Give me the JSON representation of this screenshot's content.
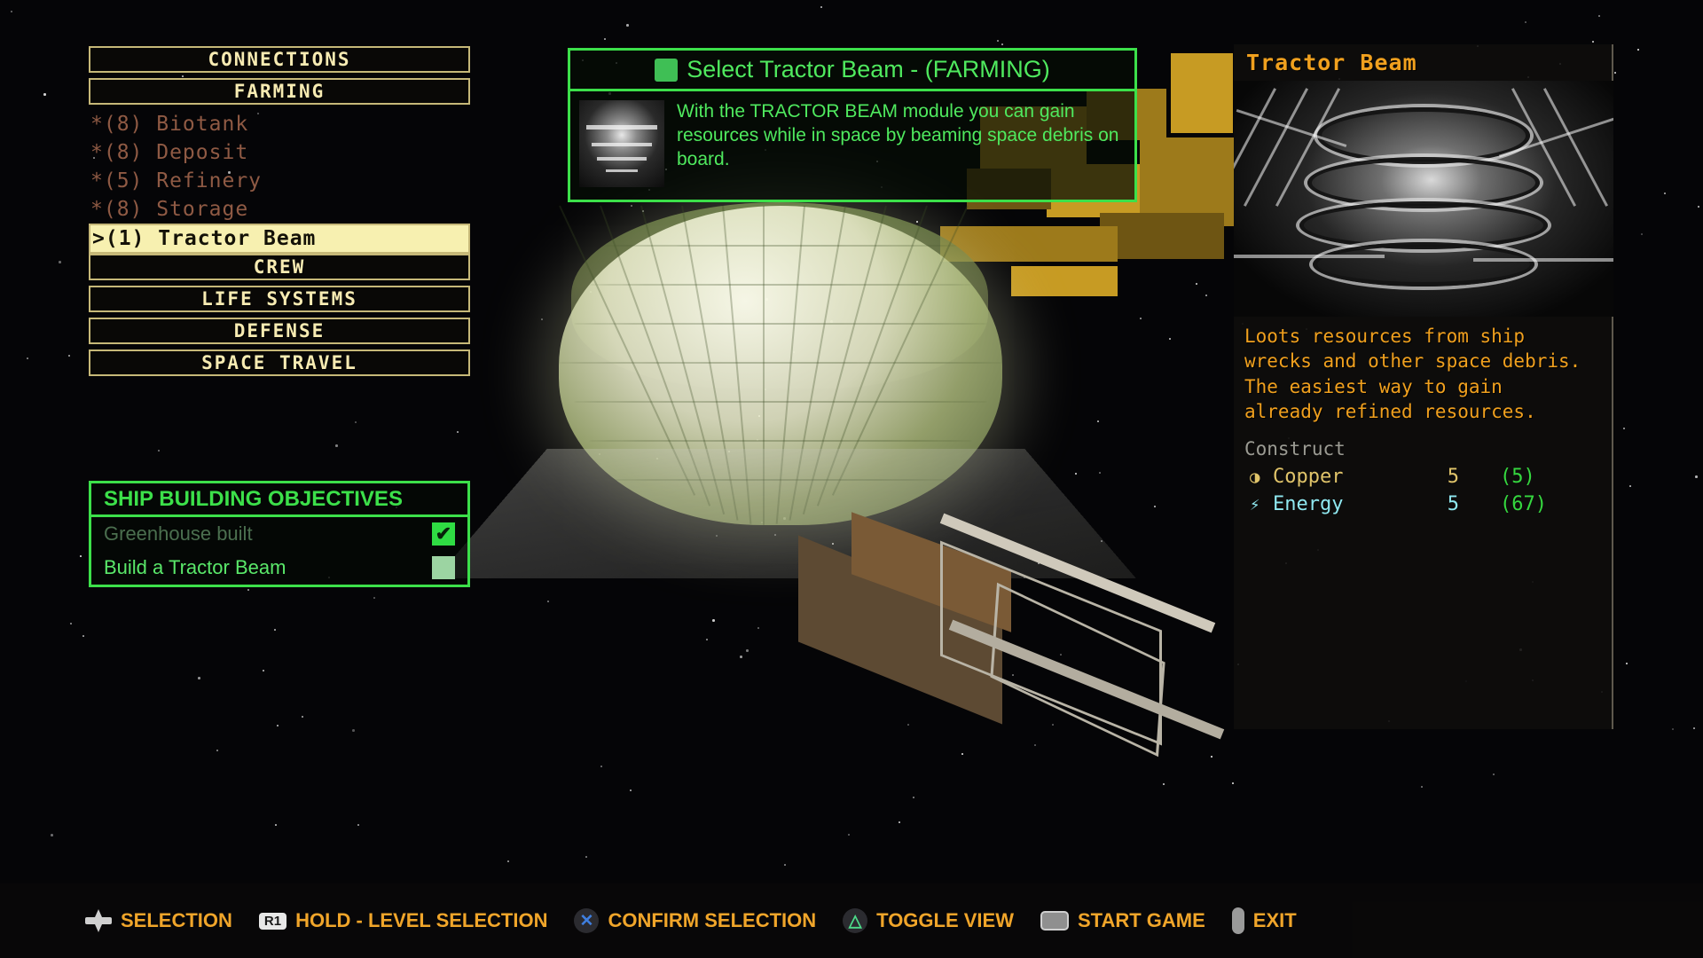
{
  "menu": {
    "items": [
      {
        "label": "CONNECTIONS",
        "type": "header"
      },
      {
        "label": "FARMING",
        "type": "header"
      },
      {
        "label": "*(8) Biotank",
        "type": "item",
        "state": "dim"
      },
      {
        "label": "*(8) Deposit",
        "type": "item",
        "state": "dim"
      },
      {
        "label": "*(5) Refinery",
        "type": "item",
        "state": "dim"
      },
      {
        "label": "*(8) Storage",
        "type": "item",
        "state": "dim"
      },
      {
        "label": ">(1) Tractor Beam",
        "type": "item",
        "state": "selected"
      },
      {
        "label": "CREW",
        "type": "header"
      },
      {
        "label": "LIFE SYSTEMS",
        "type": "header"
      },
      {
        "label": "DEFENSE",
        "type": "header"
      },
      {
        "label": "SPACE TRAVEL",
        "type": "header"
      }
    ]
  },
  "objectives": {
    "title": "SHIP BUILDING OBJECTIVES",
    "items": [
      {
        "label": "Greenhouse built",
        "checked": true,
        "check_glyph": "✔"
      },
      {
        "label": "Build a Tractor Beam",
        "checked": false,
        "check_glyph": ""
      }
    ]
  },
  "tooltip": {
    "title": "Select Tractor Beam - (FARMING)",
    "body": "With the TRACTOR BEAM module you can gain resources while in space by beaming space debris on board."
  },
  "info_panel": {
    "title": "Tractor Beam",
    "description": "Loots resources from ship\nwrecks and other space debris.\nThe easiest way to gain\nalready refined resources.",
    "construct_label": "Construct",
    "resources": [
      {
        "icon": "copper-coins-icon",
        "glyph": "◑",
        "name": "Copper",
        "amount": "5",
        "stock": "(5)"
      },
      {
        "icon": "energy-bolt-icon",
        "glyph": "⚡",
        "name": "Energy",
        "amount": "5",
        "stock": "(67)"
      }
    ]
  },
  "bottom_bar": {
    "actions": [
      {
        "icon": "dpad-icon",
        "label": "SELECTION"
      },
      {
        "icon": "r1-badge",
        "badge": "R1",
        "label": "HOLD - LEVEL SELECTION"
      },
      {
        "icon": "cross-button-icon",
        "glyph": "✕",
        "label": "CONFIRM SELECTION"
      },
      {
        "icon": "triangle-button-icon",
        "glyph": "△",
        "label": "TOGGLE VIEW"
      },
      {
        "icon": "touchpad-icon",
        "label": "START GAME"
      },
      {
        "icon": "options-button-icon",
        "label": "EXIT"
      }
    ]
  },
  "colors": {
    "menu_border": "#c6b878",
    "menu_text": "#f7ebb2",
    "menu_dim": "#8f5a44",
    "menu_selected_bg": "#f7f0b0",
    "green_accent": "#3ce04a",
    "orange_accent": "#f0a01e",
    "copper": "#e0c46a",
    "energy": "#8fe8f0",
    "stock_green": "#35d83f"
  }
}
